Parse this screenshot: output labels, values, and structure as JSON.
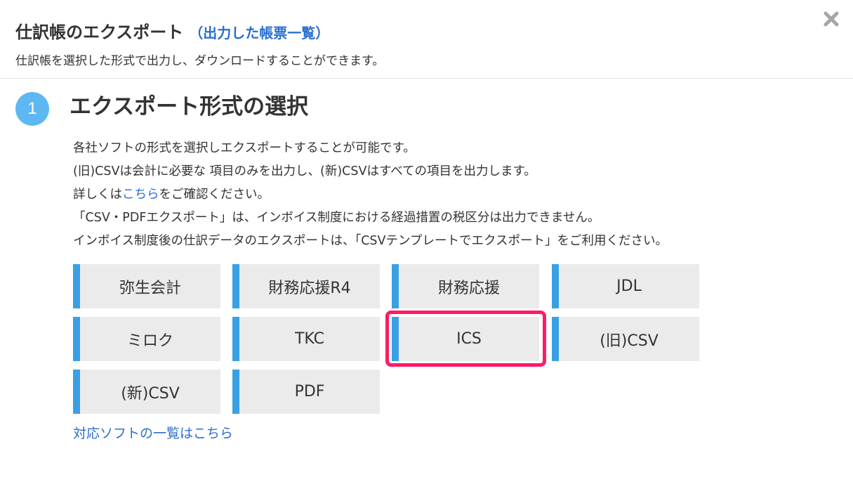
{
  "header": {
    "title": "仕訳帳のエクスポート",
    "title_link": "（出力した帳票一覧）",
    "subtitle": "仕訳帳を選択した形式で出力し、ダウンロードすることができます。"
  },
  "step": {
    "number": "1",
    "title": "エクスポート形式の選択"
  },
  "description": {
    "line1": "各社ソフトの形式を選択しエクスポートすることが可能です。",
    "line2": "(旧)CSVは会計に必要な 項目のみを出力し、(新)CSVはすべての項目を出力します。",
    "line3_prefix": "詳しくは",
    "line3_link": "こちら",
    "line3_suffix": "をご確認ください。",
    "line4": "「CSV・PDFエクスポート」は、インボイス制度における経過措置の税区分は出力できません。",
    "line5": "インボイス制度後の仕訳データのエクスポートは、「CSVテンプレートでエクスポート」をご利用ください。"
  },
  "formats": [
    {
      "label": "弥生会計"
    },
    {
      "label": "財務応援R4"
    },
    {
      "label": "財務応援"
    },
    {
      "label": "JDL"
    },
    {
      "label": "ミロク"
    },
    {
      "label": "TKC"
    },
    {
      "label": "ICS",
      "highlighted": true
    },
    {
      "label": "(旧)CSV"
    },
    {
      "label": "(新)CSV"
    },
    {
      "label": "PDF"
    }
  ],
  "footer": {
    "link": "対応ソフトの一覧はこちら"
  },
  "colors": {
    "accent": "#39a0e3",
    "link": "#2a6fd1",
    "step_circle": "#5db8f2",
    "highlight_border": "#ff1a66",
    "button_bg": "#ebebeb"
  },
  "icons": {
    "close": "close-icon"
  }
}
